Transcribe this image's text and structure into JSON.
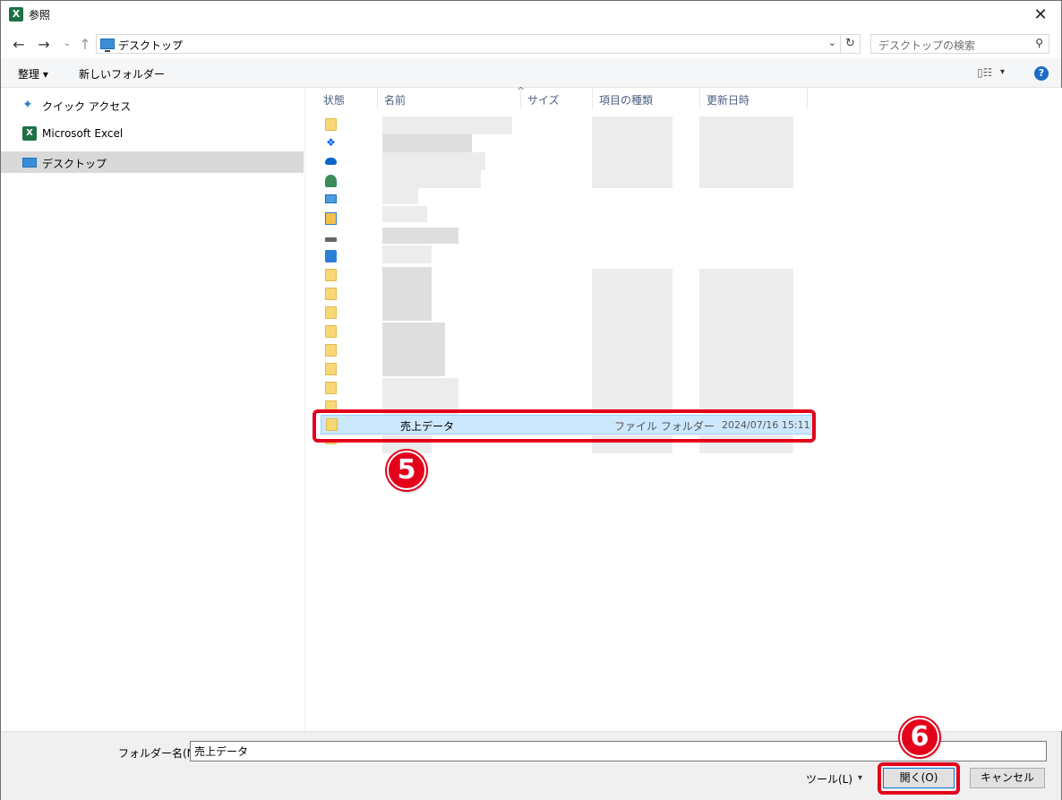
{
  "window": {
    "title": "参照",
    "app_icon": "X",
    "close_glyph": "✕"
  },
  "nav": {
    "back": "←",
    "forward": "→",
    "recent": "⌄",
    "up": "↑",
    "address": "デスクトップ",
    "address_chevron": "›",
    "address_dropdown": "⌄",
    "refresh": "↻",
    "search_placeholder": "デスクトップの検索",
    "search_glyph": "⚲"
  },
  "toolbar": {
    "organize": "整理 ▾",
    "new_folder": "新しいフォルダー",
    "view_glyph": "▯☷",
    "view_dropdown": "▾",
    "help": "?"
  },
  "sidebar": {
    "items": [
      {
        "label": "クイック アクセス",
        "icon": "star-icon"
      },
      {
        "label": "Microsoft Excel",
        "icon": "excel-icon"
      },
      {
        "label": "デスクトップ",
        "icon": "desktop-icon",
        "selected": true
      }
    ]
  },
  "columns": {
    "status": "状態",
    "name": "名前",
    "size": "サイズ",
    "type": "項目の種類",
    "date": "更新日時",
    "sort_glyph": "^"
  },
  "selected_row": {
    "name": "売上データ",
    "type": "ファイル フォルダー",
    "date": "2024/07/16 15:11"
  },
  "annotations": {
    "step5": "5",
    "step6": "6"
  },
  "footer": {
    "folder_name_label": "フォルダー名(N):",
    "folder_name_value": "売上データ",
    "tools": "ツール(L)",
    "tools_dropdown": "▾",
    "open": "開く(O)",
    "cancel": "キャンセル"
  },
  "colors": {
    "accent": "#0078d7",
    "annotation_red": "#e3001b",
    "selection": "#cce8ff"
  }
}
